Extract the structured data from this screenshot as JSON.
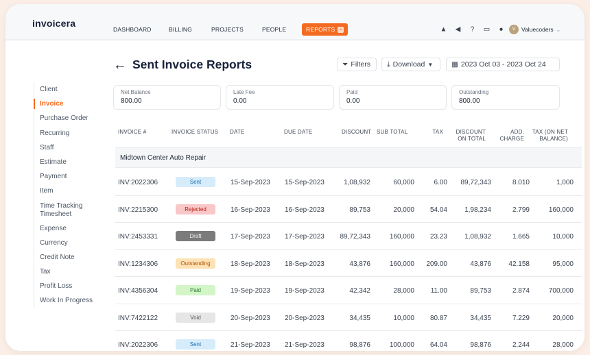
{
  "app": {
    "logo": "invoicera"
  },
  "nav": {
    "dashboard": "DASHBOARD",
    "billing": "BILLING",
    "projects": "PROJECTS",
    "people": "PEOPLE",
    "reports": "REPORTS"
  },
  "user": {
    "initials": "V",
    "name": "Valuecoders"
  },
  "sidebar": {
    "items": [
      {
        "label": "Client"
      },
      {
        "label": "Invoice"
      },
      {
        "label": "Purchase Order"
      },
      {
        "label": "Recurring"
      },
      {
        "label": "Staff"
      },
      {
        "label": "Estimate"
      },
      {
        "label": "Payment"
      },
      {
        "label": "Item"
      },
      {
        "label": "Time Tracking Timesheet"
      },
      {
        "label": "Expense"
      },
      {
        "label": "Currency"
      },
      {
        "label": "Credit Note"
      },
      {
        "label": "Tax"
      },
      {
        "label": "Profit Loss"
      },
      {
        "label": "Work In Progress"
      }
    ]
  },
  "page": {
    "title": "Sent Invoice Reports"
  },
  "toolbar": {
    "filters": "Filters",
    "download": "Download",
    "date_range": "2023 Oct 03 - 2023 Oct 24"
  },
  "summary": {
    "net_balance": {
      "label": "Net Balance",
      "value": "800.00"
    },
    "late_fee": {
      "label": "Late Fee",
      "value": "0.00"
    },
    "paid": {
      "label": "Paid",
      "value": "0.00"
    },
    "outstanding": {
      "label": "Outstanding",
      "value": "800.00"
    }
  },
  "table": {
    "headers": {
      "invoice": "INVOICE #",
      "status": "INVOICE STATUS",
      "date": "DATE",
      "due_date": "DUE DATE",
      "discount": "DISCOUNT",
      "sub_total": "SUB TOTAL",
      "tax": "TAX",
      "discount_on_total_1": "DISCOUNT",
      "discount_on_total_2": "ON TOTAL",
      "add_charge_1": "ADD.",
      "add_charge_2": "CHARGE",
      "tax_net_1": "TAX (ON NET",
      "tax_net_2": "BALANCE)"
    },
    "group": "Midtown Center Auto Repair",
    "rows": [
      {
        "invoice": "INV:2022306",
        "status": "Sent",
        "date": "15-Sep-2023",
        "due": "15-Sep-2023",
        "discount": "1,08,932",
        "sub_total": "60,000",
        "tax": "6.00",
        "disc_total": "89,72,343",
        "add_charge": "8.010",
        "tax_net": "1,000"
      },
      {
        "invoice": "INV:2215300",
        "status": "Rejected",
        "date": "16-Sep-2023",
        "due": "16-Sep-2023",
        "discount": "89,753",
        "sub_total": "20,000",
        "tax": "54.04",
        "disc_total": "1,98,234",
        "add_charge": "2.799",
        "tax_net": "160,000"
      },
      {
        "invoice": "INV:2453331",
        "status": "Draft",
        "date": "17-Sep-2023",
        "due": "17-Sep-2023",
        "discount": "89,72,343",
        "sub_total": "160,000",
        "tax": "23.23",
        "disc_total": "1,08,932",
        "add_charge": "1.665",
        "tax_net": "10,000"
      },
      {
        "invoice": "INV:1234306",
        "status": "Outstanding",
        "date": "18-Sep-2023",
        "due": "18-Sep-2023",
        "discount": "43,876",
        "sub_total": "160,000",
        "tax": "209.00",
        "disc_total": "43,876",
        "add_charge": "42.158",
        "tax_net": "95,000"
      },
      {
        "invoice": "INV:4356304",
        "status": "Paid",
        "date": "19-Sep-2023",
        "due": "19-Sep-2023",
        "discount": "42,342",
        "sub_total": "28,000",
        "tax": "11.00",
        "disc_total": "89,753",
        "add_charge": "2.874",
        "tax_net": "700,000"
      },
      {
        "invoice": "INV:7422122",
        "status": "Void",
        "date": "20-Sep-2023",
        "due": "20-Sep-2023",
        "discount": "34,435",
        "sub_total": "10,000",
        "tax": "80.87",
        "disc_total": "34,435",
        "add_charge": "7.229",
        "tax_net": "20,000"
      },
      {
        "invoice": "INV:2022306",
        "status": "Sent",
        "date": "21-Sep-2023",
        "due": "21-Sep-2023",
        "discount": "98,876",
        "sub_total": "100,000",
        "tax": "64.04",
        "disc_total": "98,876",
        "add_charge": "2.244",
        "tax_net": "28,000"
      }
    ]
  },
  "colors": {
    "accent": "#f36b21",
    "title": "#17213a"
  }
}
